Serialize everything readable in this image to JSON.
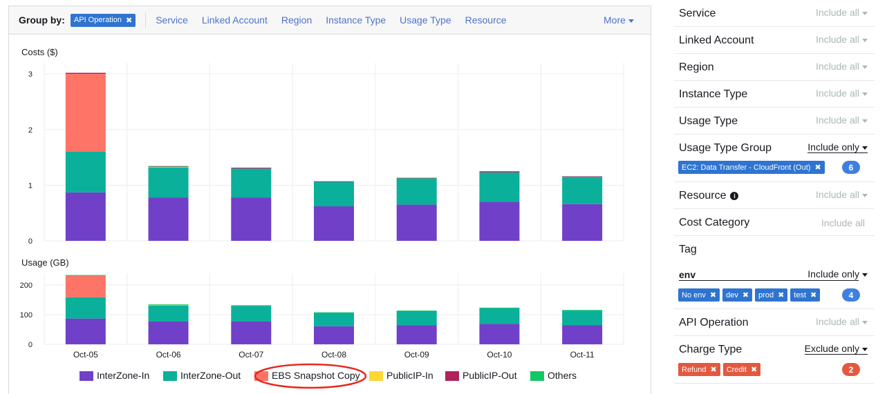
{
  "group_by": {
    "label": "Group by:",
    "selected": "API Operation",
    "options": [
      "Service",
      "Linked Account",
      "Region",
      "Instance Type",
      "Usage Type",
      "Resource"
    ],
    "more_label": "More"
  },
  "chart_data": [
    {
      "type": "bar",
      "stacked": true,
      "title": "Costs ($)",
      "categories": [
        "Oct-05",
        "Oct-06",
        "Oct-07",
        "Oct-08",
        "Oct-09",
        "Oct-10",
        "Oct-11"
      ],
      "ylim": [
        0,
        3.2
      ],
      "yticks": [
        0,
        1,
        2,
        3
      ],
      "grid": true,
      "series": [
        {
          "name": "InterZone-In",
          "color": "#7040c8",
          "values": [
            0.87,
            0.78,
            0.78,
            0.62,
            0.65,
            0.7,
            0.66
          ]
        },
        {
          "name": "InterZone-Out",
          "color": "#0bb09a",
          "values": [
            0.73,
            0.54,
            0.52,
            0.44,
            0.47,
            0.53,
            0.49
          ]
        },
        {
          "name": "EBS Snapshot Copy",
          "color": "#fe7466",
          "values": [
            1.4,
            0,
            0,
            0,
            0,
            0,
            0
          ]
        },
        {
          "name": "PublicIP-In",
          "color": "#ffd633",
          "values": [
            0,
            0.005,
            0,
            0,
            0,
            0,
            0
          ]
        },
        {
          "name": "PublicIP-Out",
          "color": "#b0225a",
          "values": [
            0.02,
            0.01,
            0.015,
            0.01,
            0.01,
            0.02,
            0.01
          ]
        },
        {
          "name": "Others",
          "color": "#13c764",
          "values": [
            0,
            0.01,
            0,
            0,
            0.005,
            0,
            0
          ]
        }
      ]
    },
    {
      "type": "bar",
      "stacked": true,
      "title": "Usage (GB)",
      "categories": [
        "Oct-05",
        "Oct-06",
        "Oct-07",
        "Oct-08",
        "Oct-09",
        "Oct-10",
        "Oct-11"
      ],
      "ylim": [
        0,
        240
      ],
      "yticks": [
        0,
        100,
        200
      ],
      "grid": true,
      "series": [
        {
          "name": "InterZone-In",
          "color": "#7040c8",
          "values": [
            87,
            77,
            77,
            61,
            64,
            69,
            65
          ]
        },
        {
          "name": "InterZone-Out",
          "color": "#0bb09a",
          "values": [
            72,
            55,
            53,
            45,
            48,
            53,
            49
          ]
        },
        {
          "name": "EBS Snapshot Copy",
          "color": "#fe7466",
          "values": [
            72,
            0,
            0,
            0,
            0,
            0,
            0
          ]
        },
        {
          "name": "PublicIP-In",
          "color": "#ffd633",
          "values": [
            0,
            1,
            0,
            0,
            0,
            0,
            0
          ]
        },
        {
          "name": "PublicIP-Out",
          "color": "#b0225a",
          "values": [
            0,
            0,
            0,
            0,
            0,
            0,
            0
          ]
        },
        {
          "name": "Others",
          "color": "#13c764",
          "values": [
            3,
            2,
            2,
            2,
            2,
            2,
            2
          ]
        }
      ]
    }
  ],
  "legend": {
    "items": [
      {
        "name": "InterZone-In",
        "color": "#7040c8"
      },
      {
        "name": "InterZone-Out",
        "color": "#0bb09a"
      },
      {
        "name": "EBS Snapshot Copy",
        "color": "#fe7466",
        "highlighted": true
      },
      {
        "name": "PublicIP-In",
        "color": "#ffd633"
      },
      {
        "name": "PublicIP-Out",
        "color": "#b0225a"
      },
      {
        "name": "Others",
        "color": "#13c764"
      }
    ],
    "highlight_color": "#e8271e"
  },
  "filters": {
    "service": {
      "label": "Service",
      "mode": "Include all"
    },
    "linked_account": {
      "label": "Linked Account",
      "mode": "Include all"
    },
    "region": {
      "label": "Region",
      "mode": "Include all"
    },
    "instance_type": {
      "label": "Instance Type",
      "mode": "Include all"
    },
    "usage_type": {
      "label": "Usage Type",
      "mode": "Include all"
    },
    "usage_type_group": {
      "label": "Usage Type Group",
      "mode": "Include only",
      "chips": [
        "EC2: Data Transfer - CloudFront (Out)"
      ],
      "count": "6"
    },
    "resource": {
      "label": "Resource",
      "mode": "Include all"
    },
    "cost_category": {
      "label": "Cost Category",
      "mode": "Include all"
    },
    "tag": {
      "label": "Tag",
      "key": "env",
      "mode": "Include only",
      "chips": [
        "No env",
        "dev",
        "prod",
        "test"
      ],
      "count": "4"
    },
    "api_operation": {
      "label": "API Operation",
      "mode": "Include all"
    },
    "charge_type": {
      "label": "Charge Type",
      "mode": "Exclude only",
      "chips": [
        "Refund",
        "Credit"
      ],
      "count": "2"
    }
  },
  "colors": {
    "accent": "#2f74d0",
    "link": "#4e72c9",
    "exclude": "#e2593f",
    "count_blue": "#3f7fe0",
    "count_red": "#e2593f"
  }
}
